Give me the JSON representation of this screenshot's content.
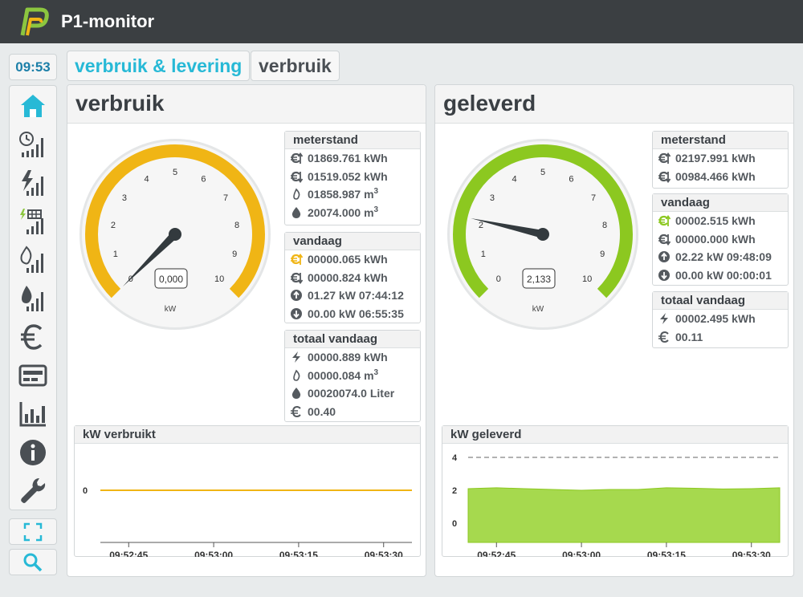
{
  "app": {
    "title": "P1-monitor",
    "brand_color": "#8cc63f"
  },
  "clock": "09:53",
  "tabs": [
    {
      "label": "verbruik & levering",
      "active": true
    },
    {
      "label": "verbruik",
      "active": false
    }
  ],
  "sidebar": {
    "items": [
      {
        "icon": "home-icon",
        "active": true
      },
      {
        "icon": "clock-signal-icon"
      },
      {
        "icon": "power-signal-icon"
      },
      {
        "icon": "solar-signal-icon"
      },
      {
        "icon": "gas-flame-signal-icon"
      },
      {
        "icon": "water-drop-signal-icon"
      },
      {
        "icon": "euro-icon"
      },
      {
        "icon": "meter-icon"
      },
      {
        "icon": "bar-chart-icon"
      },
      {
        "icon": "info-icon"
      },
      {
        "icon": "wrench-icon"
      }
    ],
    "bottom": [
      {
        "icon": "fullscreen-icon"
      },
      {
        "icon": "search-icon"
      }
    ]
  },
  "panels": {
    "verbruik": {
      "title": "verbruik",
      "gauge": {
        "value": 0.0,
        "display": "0,000",
        "unit": "kW",
        "min": 0,
        "max": 10,
        "color": "#f0b515",
        "ticks": [
          "0",
          "1",
          "2",
          "3",
          "4",
          "5",
          "6",
          "7",
          "8",
          "9",
          "10"
        ]
      },
      "meterstand": {
        "title": "meterstand",
        "rows": [
          {
            "icon": "euro-up-icon",
            "text": "01869.761 kWh"
          },
          {
            "icon": "euro-down-icon",
            "text": "01519.052 kWh"
          },
          {
            "icon": "flame-icon",
            "text": "01858.987 m",
            "sup": "3"
          },
          {
            "icon": "drop-icon",
            "text": "20074.000 m",
            "sup": "3"
          }
        ]
      },
      "vandaag": {
        "title": "vandaag",
        "rows": [
          {
            "icon": "euro-up-icon",
            "text": "00000.065 kWh"
          },
          {
            "icon": "euro-down-icon",
            "text": "00000.824 kWh"
          },
          {
            "icon": "arrow-up-circle-icon",
            "text": "01.27 kW 07:44:12"
          },
          {
            "icon": "arrow-down-circle-icon",
            "text": "00.00 kW 06:55:35"
          }
        ]
      },
      "totaal": {
        "title": "totaal vandaag",
        "rows": [
          {
            "icon": "bolt-icon",
            "text": "00000.889 kWh"
          },
          {
            "icon": "flame-icon",
            "text": "00000.084 m",
            "sup": "3"
          },
          {
            "icon": "drop-icon",
            "text": "00020074.0 Liter"
          },
          {
            "icon": "euro-icon",
            "text": "00.40"
          }
        ]
      },
      "chart": {
        "title": "kW verbruikt",
        "x_ticks": [
          "09:52:45",
          "09:53:00",
          "09:53:15",
          "09:53:30"
        ],
        "y_ticks": [
          "0"
        ]
      }
    },
    "geleverd": {
      "title": "geleverd",
      "gauge": {
        "value": 2.133,
        "display": "2,133",
        "unit": "kW",
        "min": 0,
        "max": 10,
        "color": "#8cc820",
        "ticks": [
          "0",
          "1",
          "2",
          "3",
          "4",
          "5",
          "6",
          "7",
          "8",
          "9",
          "10"
        ]
      },
      "meterstand": {
        "title": "meterstand",
        "rows": [
          {
            "icon": "euro-up-icon",
            "text": "02197.991 kWh"
          },
          {
            "icon": "euro-down-icon",
            "text": "00984.466 kWh"
          }
        ]
      },
      "vandaag": {
        "title": "vandaag",
        "rows": [
          {
            "icon": "euro-up-icon",
            "text": "00002.515 kWh"
          },
          {
            "icon": "euro-down-icon",
            "text": "00000.000 kWh"
          },
          {
            "icon": "arrow-up-circle-icon",
            "text": "02.22 kW 09:48:09"
          },
          {
            "icon": "arrow-down-circle-icon",
            "text": "00.00 kW 00:00:01"
          }
        ]
      },
      "totaal": {
        "title": "totaal vandaag",
        "rows": [
          {
            "icon": "bolt-icon",
            "text": "00002.495 kWh"
          },
          {
            "icon": "euro-icon",
            "text": "00.11"
          }
        ]
      },
      "chart": {
        "title": "kW geleverd",
        "x_ticks": [
          "09:52:45",
          "09:53:00",
          "09:53:15",
          "09:53:30"
        ],
        "y_ticks": [
          "4",
          "2",
          "0"
        ]
      }
    }
  },
  "chart_data": [
    {
      "type": "line",
      "title": "kW verbruikt",
      "x": [
        "09:52:40",
        "09:52:45",
        "09:52:50",
        "09:52:55",
        "09:53:00",
        "09:53:05",
        "09:53:10",
        "09:53:15",
        "09:53:20",
        "09:53:25",
        "09:53:30",
        "09:53:35"
      ],
      "series": [
        {
          "values": [
            0,
            0,
            0,
            0,
            0,
            0,
            0,
            0,
            0,
            0,
            0,
            0
          ],
          "color": "#f0b515"
        }
      ],
      "xlabel": "",
      "ylabel": ""
    },
    {
      "type": "area",
      "title": "kW geleverd",
      "x": [
        "09:52:40",
        "09:52:45",
        "09:52:50",
        "09:52:55",
        "09:53:00",
        "09:53:05",
        "09:53:10",
        "09:53:15",
        "09:53:20",
        "09:53:25",
        "09:53:30",
        "09:53:35"
      ],
      "series": [
        {
          "values": [
            2.1,
            2.15,
            2.1,
            2.05,
            2.0,
            2.05,
            2.05,
            2.15,
            2.12,
            2.08,
            2.1,
            2.15
          ],
          "color": "#a6d94e"
        }
      ],
      "ylim": [
        0,
        4
      ],
      "xlabel": "",
      "ylabel": ""
    }
  ]
}
